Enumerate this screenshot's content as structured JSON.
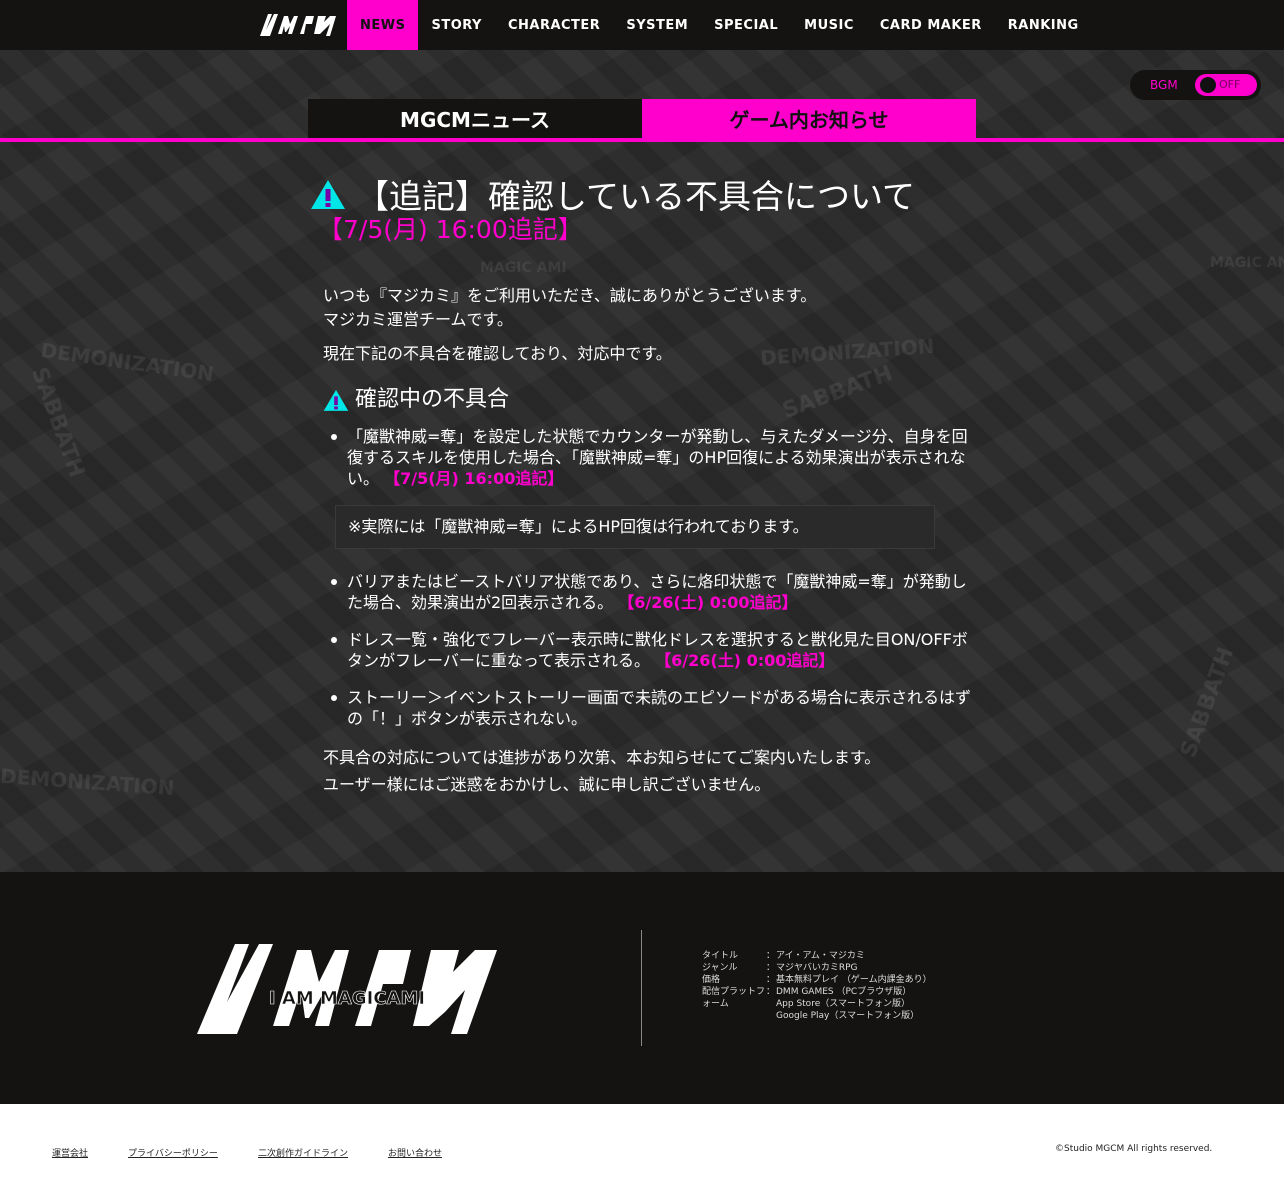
{
  "nav": {
    "logo_text": "I AM MAGICAMI",
    "items": [
      "NEWS",
      "STORY",
      "CHARACTER",
      "SYSTEM",
      "SPECIAL",
      "MUSIC",
      "CARD MAKER",
      "RANKING"
    ],
    "active": "NEWS"
  },
  "bgm": {
    "label": "BGM",
    "state": "OFF"
  },
  "tabs": {
    "news": "MGCMニュース",
    "game": "ゲーム内お知らせ"
  },
  "article": {
    "title": "【追記】確認している不具合について",
    "subtitle": "【7/5(月) 16:00追記】",
    "intro1": "いつも『マジカミ』をご利用いただき、誠にありがとうございます。",
    "intro2": "マジカミ運営チームです。",
    "intro3": "現在下記の不具合を確認しており、対応中です。",
    "section_title": "確認中の不具合",
    "issue1": "「魔獣神威=奪」を設定した状態でカウンターが発動し、与えたダメージ分、自身を回復するスキルを使用した場合、「魔獣神威=奪」のHP回復による効果演出が表示されない。",
    "issue1_tag": "【7/5(月) 16:00追記】",
    "note": "※実際には「魔獣神威=奪」によるHP回復は行われております。",
    "issue2": "バリアまたはビーストバリア状態であり、さらに烙印状態で「魔獣神威=奪」が発動した場合、効果演出が2回表示される。",
    "issue2_tag": "【6/26(土) 0:00追記】",
    "issue3": "ドレス一覧・強化でフレーバー表示時に獣化ドレスを選択すると獣化見た目ON/OFFボタンがフレーバーに重なって表示される。",
    "issue3_tag": "【6/26(土) 0:00追記】",
    "issue4": "ストーリー＞イベントストーリー画面で未読のエピソードがある場合に表示されるはずの「！」ボタンが表示されない。",
    "closing1": "不具合の対応については進捗があり次第、本お知らせにてご案内いたします。",
    "closing2": "ユーザー様にはご迷惑をおかけし、誠に申し訳ございません。"
  },
  "footer": {
    "logo_text": "I AM MAGICAMI",
    "info": [
      {
        "key": "タイトル",
        "sep": "：",
        "val": "アイ・アム・マジカミ"
      },
      {
        "key": "ジャンル",
        "sep": "：",
        "val": "マジヤバいカミRPG"
      },
      {
        "key": "価格",
        "sep": "：",
        "val": "基本無料プレイ （ゲーム内課金あり）"
      },
      {
        "key": "配信プラットフ",
        "sep": "：",
        "val": "DMM GAMES （PCブラウザ版）"
      },
      {
        "key": "ォーム",
        "sep": "",
        "val": "App Store（スマートフォン版）"
      },
      {
        "key": "",
        "sep": "",
        "val": "Google Play（スマートフォン版）"
      }
    ]
  },
  "bottom": {
    "links": [
      "運営会社",
      "プライバシーポリシー",
      "二次創作ガイドライン",
      "お問い合わせ"
    ],
    "copyright": "©Studio MGCM All rights reserved."
  },
  "colors": {
    "accent": "#ff00cc",
    "dark": "#141312",
    "warning_icon": "#00e5e5"
  }
}
